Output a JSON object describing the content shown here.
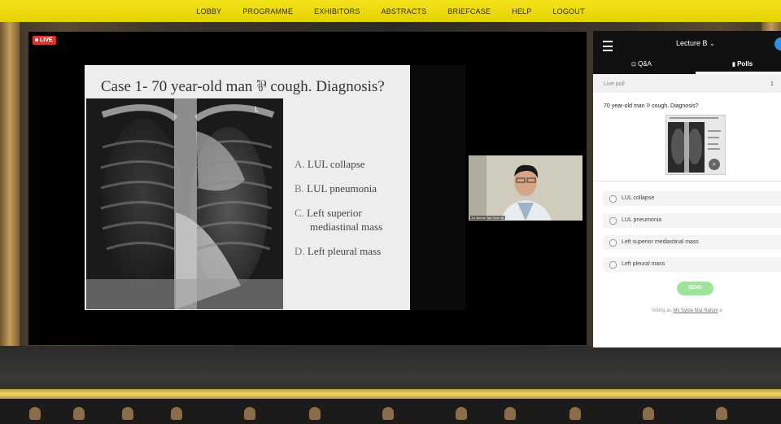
{
  "nav": {
    "items": [
      "LOBBY",
      "PROGRAMME",
      "EXHIBITORS",
      "ABSTRACTS",
      "BRIEFCASE",
      "HELP",
      "LOGOUT"
    ]
  },
  "video": {
    "live_badge": "LIVE",
    "slide_title": "Case 1- 70 year-old man ⅌ cough. Diagnosis?",
    "xray_marker": "L",
    "options": [
      {
        "letter": "A.",
        "text": "LUL collapse"
      },
      {
        "letter": "B.",
        "text": "LUL pneumonia"
      },
      {
        "letter": "C.",
        "text": "Left superior",
        "text2": "mediastinal mass"
      },
      {
        "letter": "D.",
        "text": "Left pleural mass"
      }
    ],
    "webcam_name": "Dr Bernie Tan Gee He"
  },
  "panel": {
    "menu_icon": "hamburger-icon",
    "title": "Lecture B",
    "title_chevron": "⌄",
    "tabs": [
      {
        "label": "Q&A",
        "icon": "qa-icon"
      },
      {
        "label": "Polls",
        "icon": "bar-chart-icon"
      }
    ],
    "live_poll_label": "Live poll",
    "live_poll_count": "1",
    "question": "70 year-old man ⅌ cough. Diagnosis?",
    "poll_options": [
      "LUL collapse",
      "LUL pneumonia",
      "Left superior mediastinal mass",
      "Left pleural mass"
    ],
    "send_label": "SEND",
    "voting_prefix": "Voting as",
    "voting_name": "Ms Syida Mat Rahim",
    "voting_suffix": "⌀"
  }
}
